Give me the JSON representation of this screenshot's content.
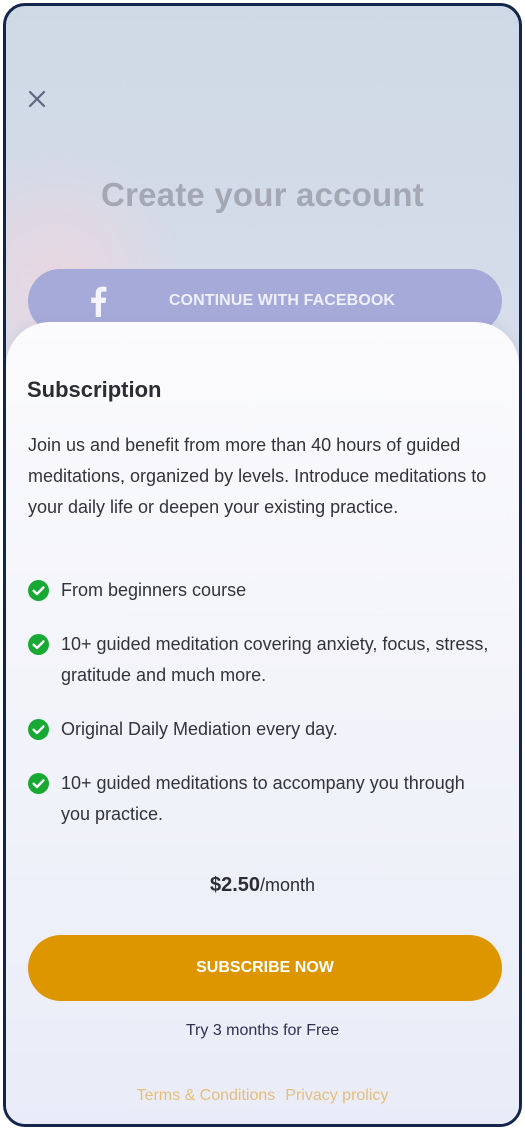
{
  "header": {
    "close_icon": "close-icon",
    "title": "Create your account"
  },
  "facebook": {
    "icon": "facebook-icon",
    "label": "CONTINUE WITH FACEBOOK",
    "color": "#a6aad9"
  },
  "subscription": {
    "title": "Subscription",
    "intro": "Join us and benefit from more than 40 hours of guided meditations, organized by levels. Introduce meditations to your daily life or deepen your existing practice.",
    "features": [
      "From beginners course",
      "10+ guided meditation covering anxiety, focus, stress, gratitude and much more.",
      "Original Daily Mediation every day.",
      "10+ guided meditations to accompany you through you practice."
    ],
    "check_icon": "check-circle-icon",
    "check_color": "#18a935",
    "price_amount": "$2.50",
    "price_period": "/month",
    "subscribe_label": "SUBSCRIBE NOW",
    "subscribe_color": "#de9600",
    "trial_text": "Try 3 months for Free"
  },
  "footer": {
    "terms": "Terms & Conditions",
    "privacy": "Privacy prolicy",
    "link_color": "#e6be78"
  }
}
